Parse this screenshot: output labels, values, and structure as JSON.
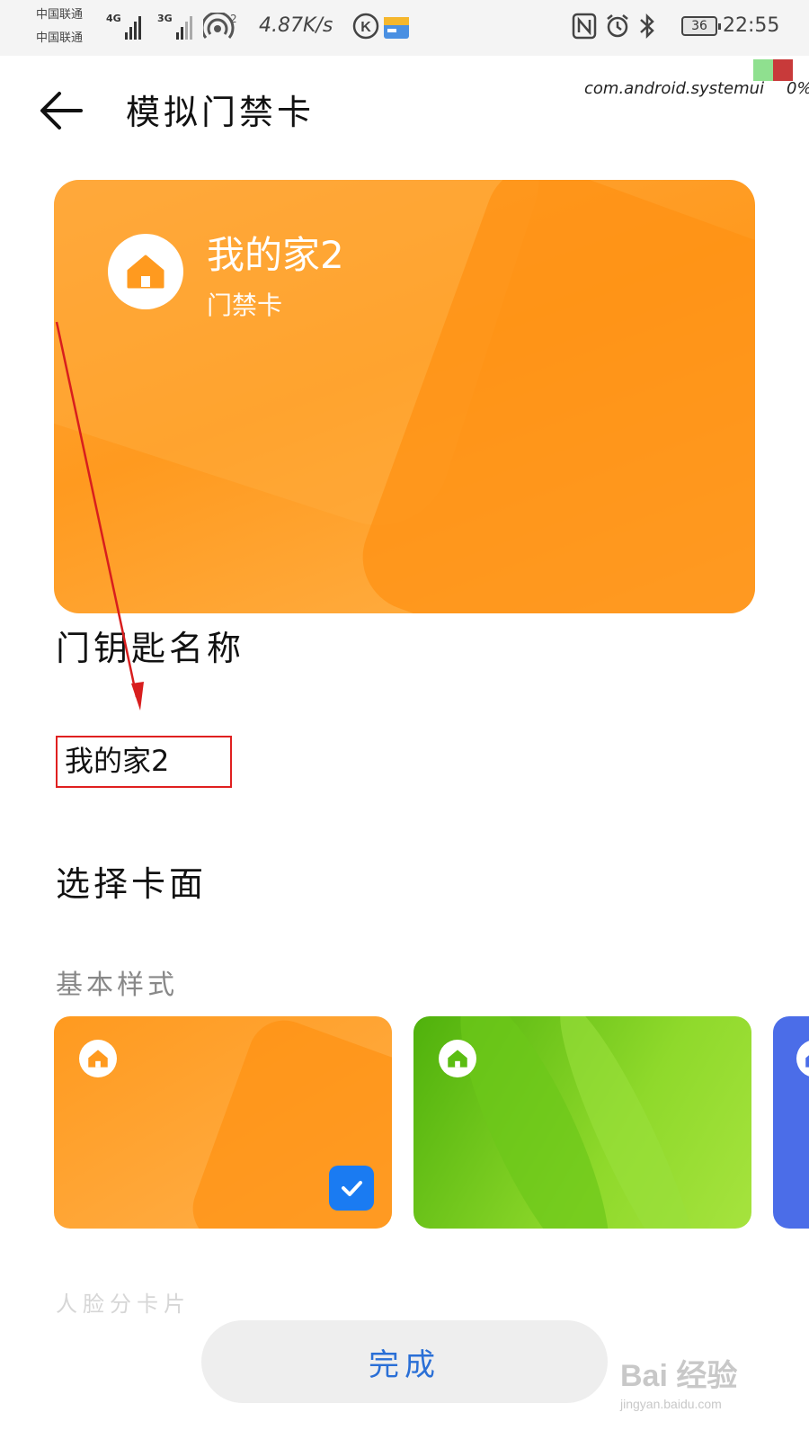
{
  "status_bar": {
    "carrier_1": "中国联通",
    "carrier_2": "中国联通",
    "net_1": "4G",
    "net_2": "3G",
    "hotspot_count": "2",
    "speed": "4.87K/s",
    "battery": "36",
    "time": "22:55"
  },
  "overlay": {
    "package": "com.android.systemui",
    "percent": "0%"
  },
  "header": {
    "title": "模拟门禁卡"
  },
  "card": {
    "name": "我的家2",
    "type": "门禁卡",
    "color": "#ff9a1f"
  },
  "key_name": {
    "label": "门钥匙名称",
    "value": "我的家2",
    "highlight_color": "#e02020"
  },
  "card_face": {
    "label": "选择卡面",
    "subsection": "基本样式",
    "options": [
      {
        "name": "orange",
        "color": "#ff9a1f",
        "selected": true
      },
      {
        "name": "green",
        "color": "#6cc81a",
        "selected": false
      },
      {
        "name": "blue",
        "color": "#4b6de8",
        "selected": false
      }
    ]
  },
  "footer": {
    "faded_label": "人脸分卡片",
    "done_label": "完成"
  },
  "watermark": {
    "brand": "Bai 经验",
    "url": "jingyan.baidu.com"
  },
  "colors": {
    "accent_blue": "#1a7bf2",
    "done_text": "#2a6fd6"
  }
}
